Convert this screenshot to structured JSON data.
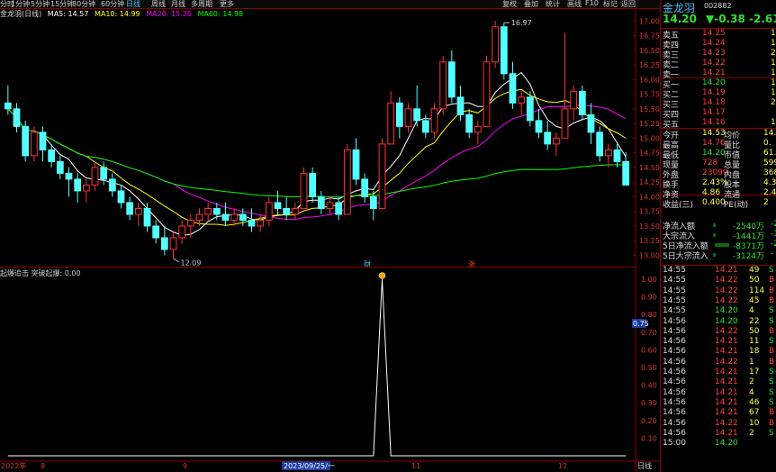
{
  "toolbar": {
    "left_items": [
      "分时",
      "1分钟",
      "5分钟",
      "15分钟",
      "30分钟",
      "60分钟",
      "日线",
      "周线",
      "月线",
      "多周期",
      "更多"
    ],
    "selected": "日线",
    "right_items": [
      "复权",
      "叠加",
      "统计",
      "画线",
      "F10",
      "标记",
      "返回"
    ]
  },
  "stock_label": "金龙羽(日线)",
  "ma_legend": {
    "ma5": "MA5: 14.57",
    "ma10": "MA10: 14.99",
    "ma20": "MA20: 15.26",
    "ma60": "MA60: 14.98",
    "colors": {
      "ma5": "#ffffff",
      "ma10": "#ffff00",
      "ma20": "#ff00ff",
      "ma60": "#00ff00"
    }
  },
  "price_axis": [
    "17.00",
    "16.75",
    "16.50",
    "16.25",
    "16.00",
    "15.75",
    "15.50",
    "15.25",
    "15.00",
    "14.75",
    "14.50",
    "14.25",
    "14.00",
    "13.75",
    "13.50",
    "13.25",
    "13.00"
  ],
  "annotations": {
    "high": "16.97",
    "low": "12.09",
    "tag1": "财",
    "tag2": "涨"
  },
  "indicator": {
    "legend": "起爆追击  突破起爆: 0.00",
    "axis": [
      "1.00",
      "0.90",
      "0.80",
      "0.70",
      "0.60",
      "0.50",
      "0.40",
      "0.30",
      "0.20",
      "0.10"
    ],
    "marker": "0.75"
  },
  "time_axis": {
    "left": "2022年",
    "mid": "2023/09/25/一",
    "right_label": "日线",
    "ticks": [
      "8",
      "9",
      "11",
      "12"
    ]
  },
  "quote": {
    "name": "金龙羽",
    "code": "002882",
    "price": "14.20",
    "change": "▼-0.38",
    "pct": "-2.61%",
    "sell": [
      {
        "label": "卖五",
        "price": "14.25",
        "vol": "1"
      },
      {
        "label": "卖四",
        "price": "14.24",
        "vol": "1"
      },
      {
        "label": "卖三",
        "price": "14.23",
        "vol": "2"
      },
      {
        "label": "卖二",
        "price": "14.22",
        "vol": "1"
      },
      {
        "label": "卖一",
        "price": "14.21",
        "vol": "1"
      }
    ],
    "buy": [
      {
        "label": "买一",
        "price": "14.20",
        "vol": "1"
      },
      {
        "label": "买二",
        "price": "14.19",
        "vol": "1"
      },
      {
        "label": "买三",
        "price": "14.18",
        "vol": "2"
      },
      {
        "label": "买四",
        "price": "14.17",
        "vol": ""
      },
      {
        "label": "买五",
        "price": "14.16",
        "vol": "1"
      }
    ],
    "stats": [
      {
        "l1": "今开",
        "v1": "14.53",
        "l2": "均价",
        "v2": "14."
      },
      {
        "l1": "最高",
        "v1": "14.76",
        "l2": "量比",
        "v2": "0."
      },
      {
        "l1": "最低",
        "v1": "14.20",
        "l2": "市值",
        "v2": "61.5"
      },
      {
        "l1": "现量",
        "v1": "728",
        "l2": "总量",
        "v2": "599"
      },
      {
        "l1": "外盘",
        "v1": "23099",
        "l2": "内盘",
        "v2": "368"
      },
      {
        "l1": "换手",
        "v1": "2.43%",
        "l2": "股本",
        "v2": "4.3"
      },
      {
        "l1": "净资",
        "v1": "4.86",
        "l2": "流通",
        "v2": "2.4"
      },
      {
        "l1": "收益(三)",
        "v1": "0.400",
        "l2": "PE(动)",
        "v2": "2"
      }
    ],
    "flows": [
      {
        "label": "净流入额",
        "v": "-2540万",
        "v2": "-2"
      },
      {
        "label": "大宗流入",
        "v": "-1441万",
        "v2": "-1"
      },
      {
        "label": "5日净流入额",
        "v": "-8371万",
        "v2": "-2"
      },
      {
        "label": "5日大宗流入",
        "v": "-3124万",
        "v2": "-"
      }
    ],
    "ticks": [
      {
        "t": "14:55",
        "p": "14.21",
        "v": "49",
        "s": "S"
      },
      {
        "t": "14:55",
        "p": "14.22",
        "v": "50",
        "s": "B"
      },
      {
        "t": "14:55",
        "p": "14.22",
        "v": "114",
        "s": "B"
      },
      {
        "t": "14:55",
        "p": "14.22",
        "v": "45",
        "s": "B"
      },
      {
        "t": "14:55",
        "p": "14.20",
        "v": "4",
        "s": "S"
      },
      {
        "t": "14:56",
        "p": "14.20",
        "v": "22",
        "s": "S"
      },
      {
        "t": "14:56",
        "p": "14.22",
        "v": "50",
        "s": "B"
      },
      {
        "t": "14:56",
        "p": "14.21",
        "v": "11",
        "s": "S"
      },
      {
        "t": "14:56",
        "p": "14.21",
        "v": "18",
        "s": "B"
      },
      {
        "t": "14:56",
        "p": "14.22",
        "v": "1",
        "s": "B"
      },
      {
        "t": "14:56",
        "p": "14.21",
        "v": "17",
        "s": "S"
      },
      {
        "t": "14:56",
        "p": "14.21",
        "v": "2",
        "s": "S"
      },
      {
        "t": "14:56",
        "p": "14.21",
        "v": "4",
        "s": "S"
      },
      {
        "t": "14:56",
        "p": "14.21",
        "v": "46",
        "s": "S"
      },
      {
        "t": "14:56",
        "p": "14.21",
        "v": "67",
        "s": "B"
      },
      {
        "t": "14:56",
        "p": "14.22",
        "v": "10",
        "s": "B"
      },
      {
        "t": "14:56",
        "p": "14.21",
        "v": "2",
        "s": "S"
      },
      {
        "t": "15:00",
        "p": "14.20",
        "v": "",
        "s": ""
      }
    ]
  },
  "chart_data": {
    "type": "candlestick",
    "ylim": [
      12.9,
      17.05
    ],
    "series": [
      {
        "name": "K",
        "ohlc": [
          [
            15.6,
            15.9,
            15.4,
            15.5
          ],
          [
            15.5,
            15.6,
            15.1,
            15.2
          ],
          [
            15.2,
            15.3,
            14.6,
            14.7
          ],
          [
            14.7,
            15.2,
            14.6,
            15.1
          ],
          [
            15.1,
            15.2,
            14.6,
            14.8
          ],
          [
            14.8,
            14.9,
            14.5,
            14.6
          ],
          [
            14.6,
            14.7,
            14.3,
            14.4
          ],
          [
            14.4,
            14.5,
            14.0,
            14.3
          ],
          [
            14.3,
            14.4,
            13.9,
            14.1
          ],
          [
            14.1,
            14.3,
            13.9,
            14.2
          ],
          [
            14.2,
            14.6,
            14.1,
            14.5
          ],
          [
            14.5,
            14.6,
            14.2,
            14.3
          ],
          [
            14.3,
            14.4,
            14.0,
            14.1
          ],
          [
            14.1,
            14.2,
            13.8,
            13.9
          ],
          [
            13.9,
            14.0,
            13.6,
            13.7
          ],
          [
            13.7,
            13.9,
            13.5,
            13.8
          ],
          [
            13.8,
            13.9,
            13.4,
            13.5
          ],
          [
            13.5,
            13.6,
            13.2,
            13.3
          ],
          [
            13.3,
            13.5,
            13.0,
            13.1
          ],
          [
            13.1,
            13.4,
            12.95,
            13.3
          ],
          [
            13.3,
            13.6,
            13.2,
            13.5
          ],
          [
            13.5,
            13.7,
            13.3,
            13.6
          ],
          [
            13.6,
            13.8,
            13.5,
            13.7
          ],
          [
            13.7,
            13.9,
            13.6,
            13.8
          ],
          [
            13.8,
            13.9,
            13.6,
            13.7
          ],
          [
            13.7,
            13.9,
            13.5,
            13.6
          ],
          [
            13.6,
            13.8,
            13.5,
            13.7
          ],
          [
            13.7,
            13.8,
            13.5,
            13.6
          ],
          [
            13.6,
            13.8,
            13.4,
            13.5
          ],
          [
            13.5,
            13.7,
            13.4,
            13.6
          ],
          [
            13.6,
            14.0,
            13.5,
            13.9
          ],
          [
            13.9,
            14.1,
            13.7,
            13.8
          ],
          [
            13.8,
            14.0,
            13.6,
            13.7
          ],
          [
            13.7,
            13.9,
            13.6,
            13.8
          ],
          [
            13.8,
            14.5,
            13.8,
            14.4
          ],
          [
            14.4,
            14.5,
            13.9,
            14.0
          ],
          [
            14.0,
            14.1,
            13.7,
            13.8
          ],
          [
            13.8,
            14.0,
            13.7,
            13.9
          ],
          [
            13.9,
            14.0,
            13.6,
            13.7
          ],
          [
            13.7,
            14.9,
            13.7,
            14.8
          ],
          [
            14.8,
            15.0,
            14.2,
            14.3
          ],
          [
            14.3,
            14.4,
            13.9,
            14.0
          ],
          [
            14.0,
            14.1,
            13.6,
            13.8
          ],
          [
            13.8,
            15.0,
            13.8,
            14.9
          ],
          [
            14.9,
            15.8,
            14.9,
            15.6
          ],
          [
            15.6,
            15.7,
            15.0,
            15.2
          ],
          [
            15.2,
            15.6,
            15.1,
            15.5
          ],
          [
            15.5,
            15.9,
            15.2,
            15.3
          ],
          [
            15.3,
            15.4,
            15.0,
            15.1
          ],
          [
            15.1,
            15.6,
            15.0,
            15.5
          ],
          [
            15.5,
            16.4,
            15.4,
            16.3
          ],
          [
            16.3,
            16.5,
            15.6,
            15.7
          ],
          [
            15.7,
            15.9,
            15.3,
            15.4
          ],
          [
            15.4,
            15.5,
            15.0,
            15.1
          ],
          [
            15.1,
            15.3,
            14.9,
            15.2
          ],
          [
            15.2,
            16.4,
            15.2,
            16.3
          ],
          [
            16.3,
            17.0,
            16.2,
            16.9
          ],
          [
            16.9,
            16.97,
            16.0,
            16.1
          ],
          [
            16.1,
            16.3,
            15.5,
            15.6
          ],
          [
            15.6,
            15.8,
            15.4,
            15.7
          ],
          [
            15.7,
            15.8,
            15.2,
            15.3
          ],
          [
            15.3,
            15.5,
            15.0,
            15.1
          ],
          [
            15.1,
            15.3,
            14.8,
            14.9
          ],
          [
            14.9,
            15.1,
            14.7,
            15.0
          ],
          [
            15.0,
            16.8,
            15.0,
            15.5
          ],
          [
            15.5,
            15.9,
            15.3,
            15.8
          ],
          [
            15.8,
            15.9,
            15.3,
            15.4
          ],
          [
            15.4,
            15.6,
            14.9,
            15.1
          ],
          [
            15.1,
            15.2,
            14.6,
            14.7
          ],
          [
            14.7,
            14.9,
            14.5,
            14.8
          ],
          [
            14.8,
            14.9,
            14.5,
            14.6
          ],
          [
            14.6,
            14.76,
            14.2,
            14.2
          ]
        ]
      },
      {
        "name": "MA5",
        "color": "#ffffff"
      },
      {
        "name": "MA10",
        "color": "#ffff00"
      },
      {
        "name": "MA20",
        "color": "#ff00ff"
      },
      {
        "name": "MA60",
        "color": "#00ff00"
      }
    ],
    "indicator_series": [
      0,
      0,
      0,
      0,
      0,
      0,
      0,
      0,
      0,
      0,
      0,
      0,
      0,
      0,
      0,
      0,
      0,
      0,
      0,
      0,
      0,
      0,
      0,
      0,
      0,
      0,
      0,
      0,
      0,
      0,
      0,
      0,
      0,
      0,
      0,
      0,
      0,
      0,
      0,
      0,
      0,
      0,
      0,
      1,
      0,
      0,
      0,
      0,
      0,
      0,
      0,
      0,
      0,
      0,
      0,
      0,
      0,
      0,
      0,
      0,
      0,
      0,
      0,
      0,
      0,
      0,
      0,
      0,
      0,
      0,
      0,
      0
    ]
  }
}
